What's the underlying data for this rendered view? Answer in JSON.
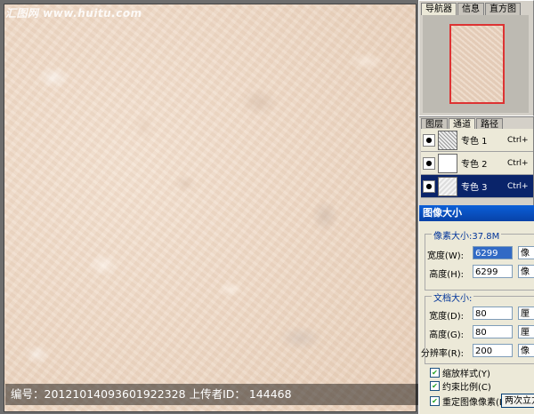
{
  "canvas": {
    "watermark_top": "汇图网 www.huitu.com",
    "caption": {
      "id_label": "编号：",
      "id_value": "20121014093601922328",
      "uploader_label": "上传者ID：",
      "uploader_value": "144468"
    }
  },
  "navigator_panel": {
    "tabs": [
      "导航器",
      "信息",
      "直方图"
    ],
    "active_tab": "导航器"
  },
  "channels_panel": {
    "tabs": [
      "图层",
      "通道",
      "路径"
    ],
    "active_tab": "通道",
    "channels": [
      {
        "name": "专色 1",
        "shortcut": "Ctrl+"
      },
      {
        "name": "专色 2",
        "shortcut": "Ctrl+"
      },
      {
        "name": "专色 3",
        "shortcut": "Ctrl+",
        "selected": true
      }
    ]
  },
  "image_size_dialog": {
    "title": "图像大小",
    "pixel_group": {
      "title": "像素大小:37.8M",
      "width_label": "宽度(W):",
      "width_value": "6299",
      "width_unit": "像",
      "height_label": "高度(H):",
      "height_value": "6299",
      "height_unit": "像"
    },
    "doc_group": {
      "title": "文档大小:",
      "width_label": "宽度(D):",
      "width_value": "80",
      "width_unit": "厘",
      "height_label": "高度(G):",
      "height_value": "80",
      "height_unit": "厘",
      "res_label": "分辨率(R):",
      "res_value": "200",
      "res_unit": "像"
    },
    "checkboxes": [
      {
        "label": "缩放样式(Y)",
        "checked": true
      },
      {
        "label": "约束比例(C)",
        "checked": true
      },
      {
        "label": "重定图像像素(I):",
        "checked": true
      }
    ],
    "resample_value": "两次立方"
  },
  "colors": {
    "selection_blue": "#0a246a",
    "title_blue": "#0a5fd8",
    "navigator_frame_red": "#d33333"
  }
}
